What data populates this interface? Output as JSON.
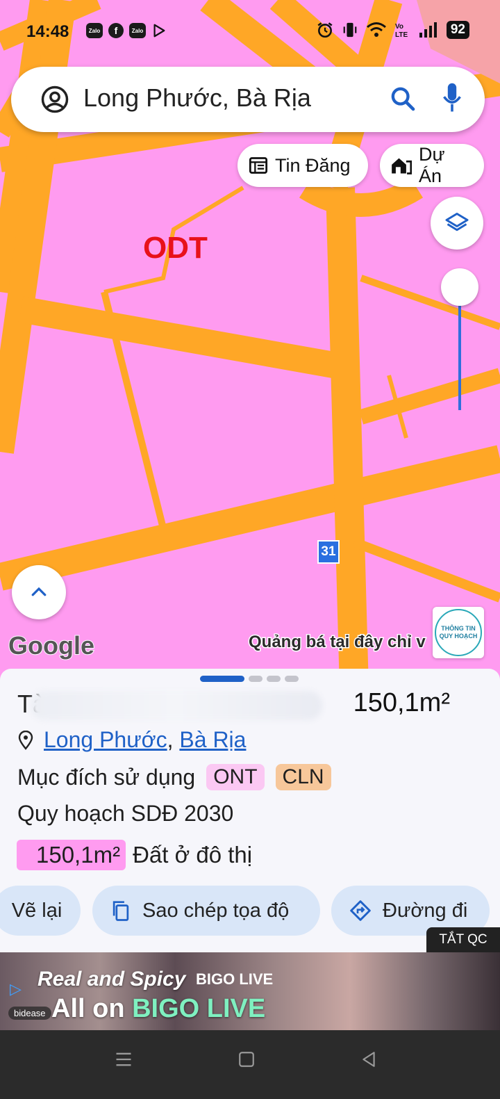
{
  "status_bar": {
    "time": "14:48",
    "battery": "92",
    "app_icons": [
      "Zalo",
      "facebook-icon",
      "Zalo",
      "play-icon"
    ]
  },
  "search": {
    "text": "Long Phước, Bà Rịa"
  },
  "chips": {
    "listings": "Tin Đăng",
    "projects": "Dự Án"
  },
  "map": {
    "zone_label": "ODT",
    "route_number": "31",
    "google_logo": "Google",
    "promo_text": "Quảng bá tại đây chỉ v",
    "info_badge_line1": "THÔNG TIN",
    "info_badge_line2": "QUY HOẠCH",
    "land_color": "#ff9bf0",
    "road_color": "#ffa726"
  },
  "sheet": {
    "title_partial": "Tà",
    "area": "150,1m²",
    "location": {
      "ward": "Long Phước",
      "separator": ",",
      "city": "Bà Rịa"
    },
    "purpose_label": "Mục đích sử dụng",
    "purpose_tags": [
      {
        "code": "ONT",
        "color": "#fbc8f3"
      },
      {
        "code": "CLN",
        "color": "#f7c79a"
      }
    ],
    "plan_label": "Quy hoạch SDĐ 2030",
    "land_area": "150,1m²",
    "land_type": "Đất ở đô thị",
    "actions": {
      "redraw": "Vẽ lại",
      "copy_coords": "Sao chép tọa độ",
      "directions": "Đường đi"
    }
  },
  "ad": {
    "close_label": "TẮT QC",
    "line1": "Real and Spicy",
    "brand": "BIGO LIVE",
    "line2_prefix": "All on",
    "line2_brand": "BIGO LIVE",
    "network": "bidease"
  }
}
